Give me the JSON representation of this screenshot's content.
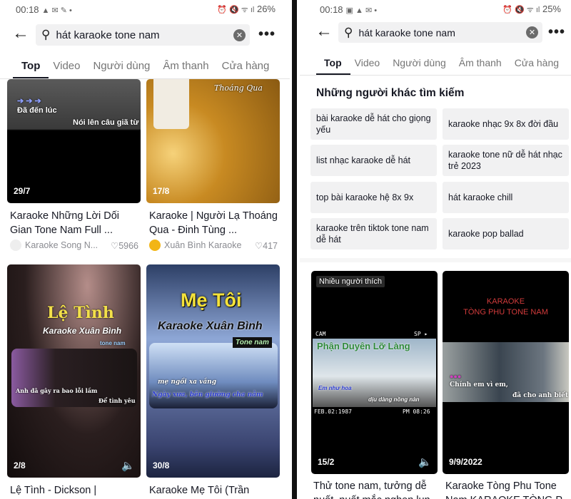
{
  "left": {
    "status": {
      "time": "00:18",
      "left_icons": "▲ ✉ ✎ •",
      "right_icons": "⏰ 🔇 ᯤ ıl",
      "battery": "26%"
    },
    "search": {
      "query": "hát karaoke tone nam"
    },
    "tabs": [
      "Top",
      "Video",
      "Người dùng",
      "Âm thanh",
      "Cửa hàng"
    ],
    "active_tab": "Top",
    "videos": [
      {
        "date": "29/7",
        "overlay": [
          "Đã đến lúc",
          "Nói lên câu giã từ"
        ],
        "title": "Karaoke Những Lời Dối Gian Tone Nam Full ...",
        "author": "Karaoke Song N...",
        "likes": "5966"
      },
      {
        "date": "17/8",
        "overlay": [
          "Thoáng Qua"
        ],
        "title": "Karaoke | Người Lạ Thoáng Qua - Đinh Tùng ...",
        "author": "Xuân Bình Karaoke",
        "likes": "417"
      },
      {
        "date": "2/8",
        "overlay": [
          "Lệ Tình",
          "Karaoke Xuân Bình",
          "tone nam",
          "Anh đã gây ra bao lỗi lầm",
          "Để tình yêu"
        ],
        "title": "Lệ Tình - Dickson |",
        "sound": true
      },
      {
        "date": "30/8",
        "overlay": [
          "Mẹ Tôi",
          "Karaoke Xuân Bình",
          "Tone nam",
          "mẹ ngồi xa vắng",
          "Ngày xưa, bên giường cha nằm"
        ],
        "title": "Karaoke Mẹ Tôi (Trần"
      }
    ]
  },
  "right": {
    "status": {
      "time": "00:18",
      "left_icons": "▣ ▲ ✉ •",
      "right_icons": "⏰ 🔇 ᯤ ıl",
      "battery": "25%"
    },
    "search": {
      "query": "hát karaoke tone nam"
    },
    "tabs": [
      "Top",
      "Video",
      "Người dùng",
      "Âm thanh",
      "Cửa hàng"
    ],
    "active_tab": "Top",
    "others_heading": "Những người khác tìm kiếm",
    "suggestions": [
      "bài karaoke dễ hát cho giọng yếu",
      "karaoke nhạc 9x 8x đời đầu",
      "list nhạc karaoke dễ hát",
      "karaoke tone nữ dễ hát nhạc trẻ 2023",
      "top bài karaoke hệ 8x 9x",
      "hát karaoke chill",
      "karaoke trên tiktok tone nam dễ hát",
      "karaoke pop ballad"
    ],
    "videos": [
      {
        "badge": "Nhiều người thích",
        "date": "15/2",
        "overlay": [
          "CAM",
          "SP ▸",
          "Phận Duyên Lỡ Làng",
          "Em như hoa",
          "dịu dàng nồng nàn",
          "FEB.02:1987",
          "PM 08:26"
        ],
        "title": "Thử tone nam, tưởng dễ nuốt, nuốt mắc nghẹn lun",
        "sound": true
      },
      {
        "date": "9/9/2022",
        "overlay": [
          "KARAOKE",
          "TÒNG PHU TONE NAM",
          "Chính em vì em,",
          "đã cho anh biết"
        ],
        "title": "Karaoke Tòng Phu Tone Nam KARAOKE TÒNG P..."
      }
    ]
  },
  "colors": {
    "accent": "#161823",
    "chip_bg": "#f1f1f2",
    "muted": "#8a8b91"
  }
}
